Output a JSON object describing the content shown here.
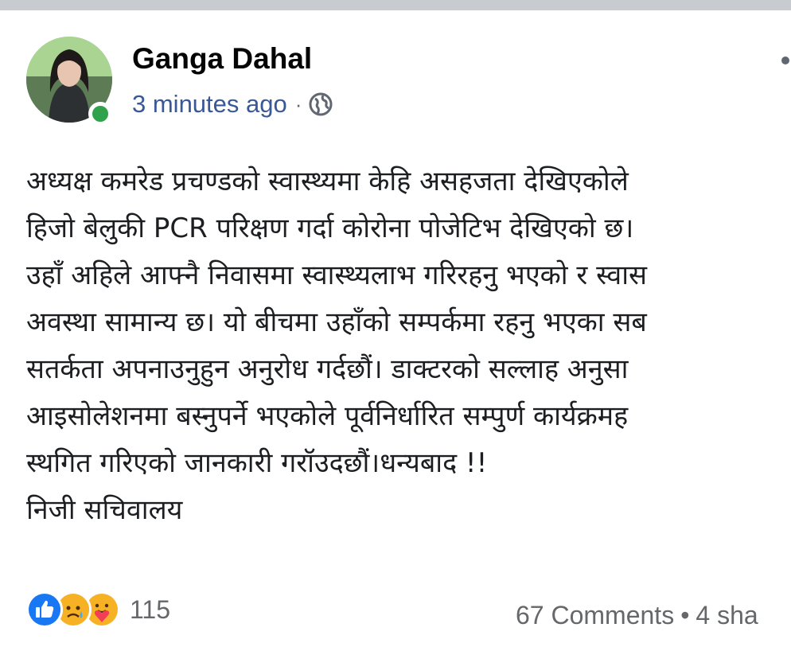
{
  "post": {
    "author": "Ganga Dahal",
    "timestamp": "3 minutes ago",
    "separator": "·",
    "visibility_icon": "globe-icon",
    "more_icon": "more-options-icon",
    "text_lines": [
      "अध्यक्ष कमरेड प्रचण्डको स्वास्थ्यमा केहि असहजता देखिएकोले",
      "हिजो बेलुकी PCR परिक्षण गर्दा कोरोना पोजेटिभ देखिएको छ।",
      "उहाँ अहिले आफ्नै निवासमा स्वास्थ्यलाभ गरिरहनु भएको र स्वास",
      "अवस्था सामान्य छ। यो बीचमा उहाँको सम्पर्कमा रहनु भएका सब",
      "सतर्कता अपनाउनुहुन अनुरोध गर्दछौं। डाक्टरको सल्लाह अनुसा",
      "आइसोलेशनमा बस्नुपर्ने भएकोले पूर्वनिर्धारित सम्पुर्ण कार्यक्रमह",
      "स्थगित गरिएको जानकारी गरॉउदछौं।धन्यबाद !!",
      "निजी सचिवालय"
    ]
  },
  "footer": {
    "reaction_icons": [
      "like-icon",
      "sad-icon",
      "care-icon"
    ],
    "reaction_count": "115",
    "comments": "67 Comments",
    "dot": "•",
    "shares": "4 sha"
  },
  "colors": {
    "author": "#050505",
    "timestamp": "#385898",
    "online": "#31a24c",
    "text": "#1c1e21",
    "muted": "#65676b",
    "like_blue": "#1877f2"
  }
}
